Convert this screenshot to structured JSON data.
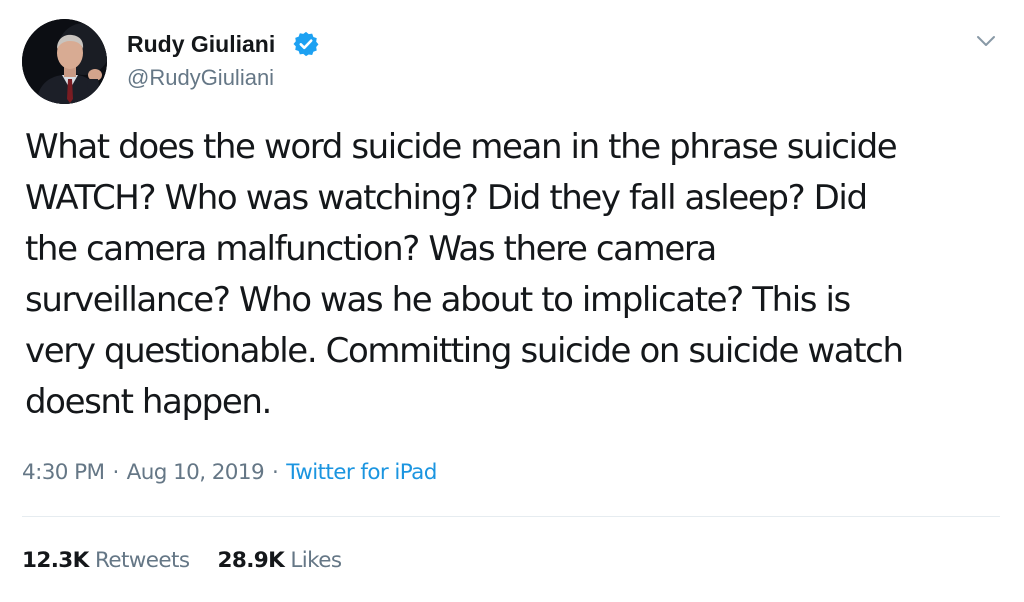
{
  "author": {
    "display_name": "Rudy Giuliani",
    "handle": "@RudyGiuliani",
    "verified_icon": "verified-badge-icon",
    "avatar_icon": "profile-photo"
  },
  "menu_icon": "chevron-down-icon",
  "tweet": {
    "text_lines": [
      "What does the word suicide mean in the phrase suicide",
      "WATCH? Who was watching? Did they fall asleep? Did",
      "the camera malfunction? Was there camera",
      "surveillance? Who was he about to implicate? This is",
      "very questionable. Committing suicide on suicide watch",
      "doesnt happen."
    ]
  },
  "meta": {
    "time": "4:30 PM",
    "separator": "·",
    "date": "Aug 10, 2019",
    "source": "Twitter for iPad"
  },
  "stats": {
    "retweets_count": "12.3K",
    "retweets_label": "Retweets",
    "likes_count": "28.9K",
    "likes_label": "Likes"
  },
  "colors": {
    "text": "#14171a",
    "secondary": "#657786",
    "link": "#1b95e0",
    "verified": "#1da1f2",
    "divider": "#e6ecf0"
  }
}
